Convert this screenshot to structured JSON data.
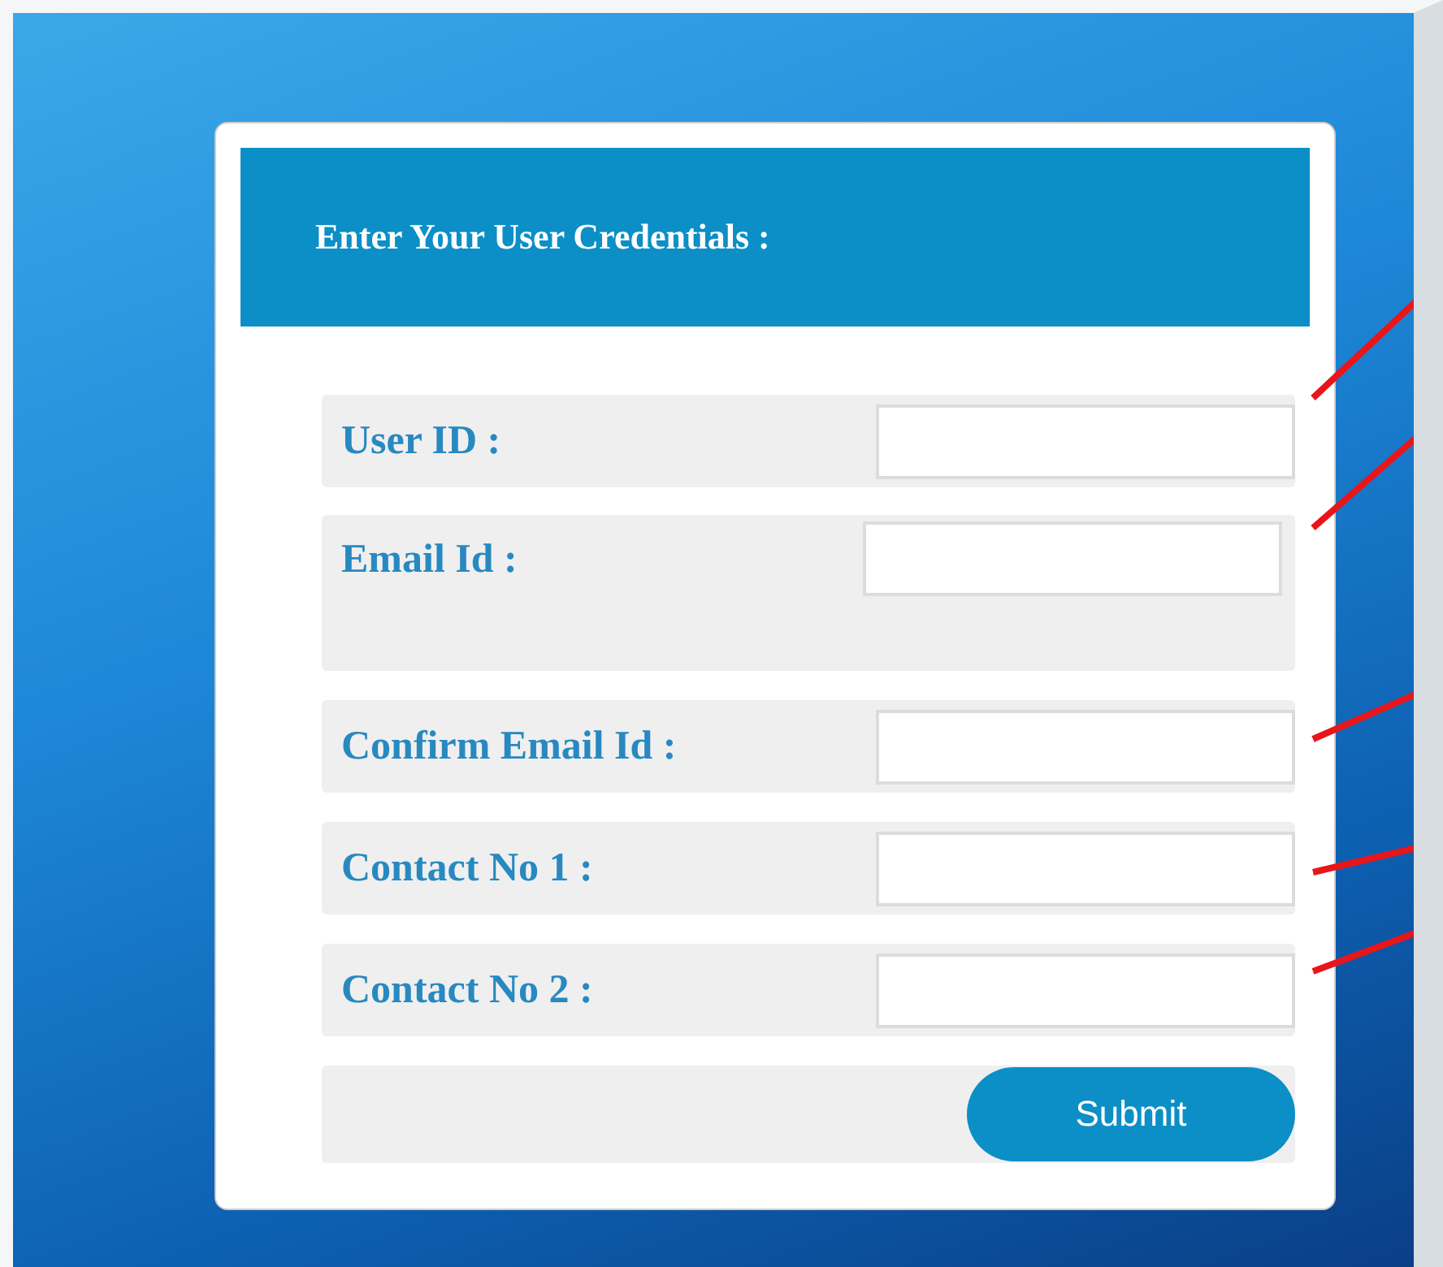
{
  "form": {
    "title": "Enter Your User Credentials :",
    "fields": [
      {
        "label": "User ID :",
        "kind": "single"
      },
      {
        "label": "Email Id :",
        "kind": "tall"
      },
      {
        "label": "Confirm Email Id :",
        "kind": "single"
      },
      {
        "label": "Contact No 1 :",
        "kind": "single"
      },
      {
        "label": "Contact No 2 :",
        "kind": "single"
      }
    ],
    "submit": "Submit"
  }
}
